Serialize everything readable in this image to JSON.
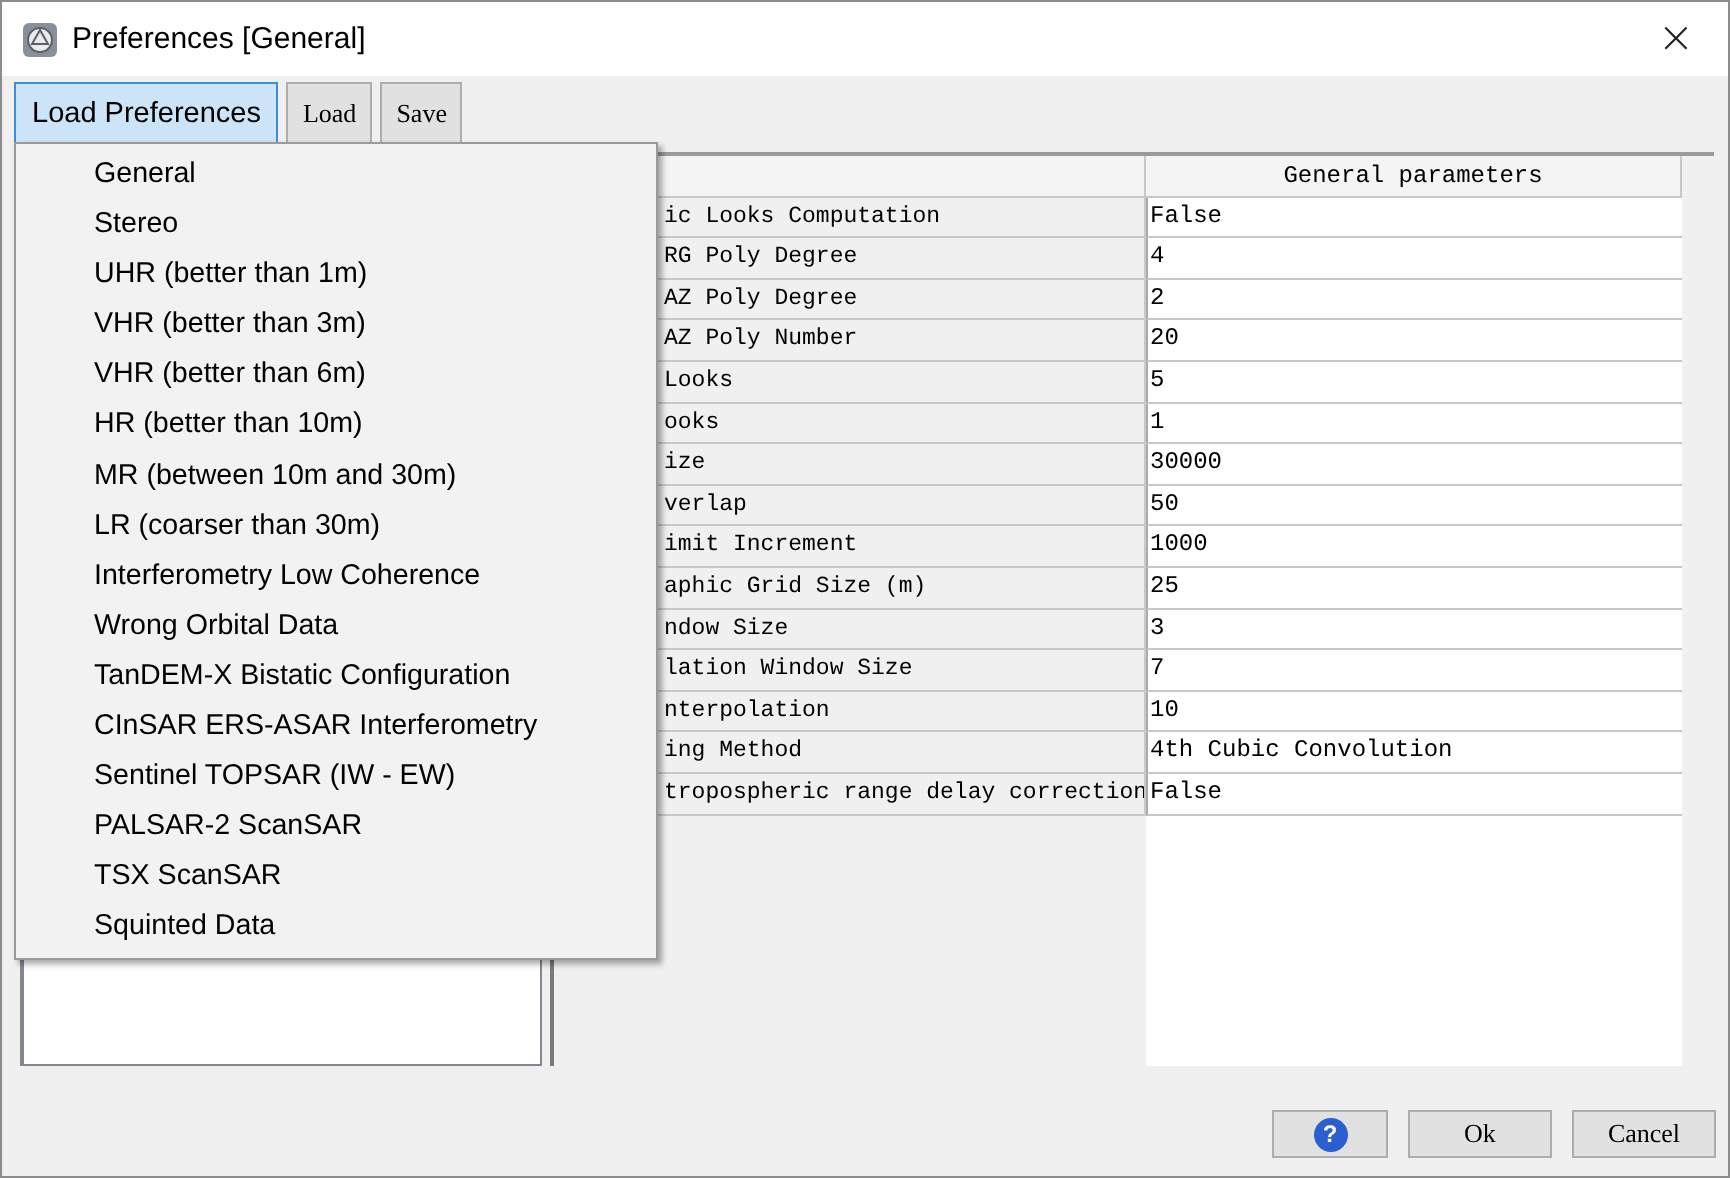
{
  "window": {
    "title": "Preferences [General]",
    "close": "×"
  },
  "toolbar": [
    {
      "label": "Load Preferences",
      "pressed": true,
      "kind": "menu"
    },
    {
      "label": "Load",
      "pressed": false,
      "kind": "plain"
    },
    {
      "label": "Save",
      "pressed": false,
      "kind": "plain"
    }
  ],
  "menu": {
    "items": [
      {
        "label": "General"
      },
      {
        "label": "Stereo"
      },
      {
        "label": "UHR (better than 1m)"
      },
      {
        "label": "VHR (better than 3m)"
      },
      {
        "label": "VHR (better than 6m)"
      },
      {
        "label": "HR (better than 10m)"
      },
      {
        "label": "MR (between 10m and 30m)"
      },
      {
        "label": "LR (coarser than 30m)"
      },
      {
        "label": "Interferometry Low Coherence"
      },
      {
        "label": "Wrong Orbital Data"
      },
      {
        "label": "TanDEM-X Bistatic Configuration"
      },
      {
        "label": "CInSAR ERS-ASAR Interferometry"
      },
      {
        "label": "Sentinel TOPSAR (IW - EW)"
      },
      {
        "label": "PALSAR-2 ScanSAR"
      },
      {
        "label": "TSX ScanSAR"
      },
      {
        "label": "Squinted Data"
      }
    ]
  },
  "table": {
    "header": "General parameters",
    "rows": [
      {
        "name": "ic Looks Computation",
        "value": "False"
      },
      {
        "name": "RG Poly Degree",
        "value": "4"
      },
      {
        "name": "AZ Poly Degree",
        "value": "2"
      },
      {
        "name": "AZ Poly Number",
        "value": "20"
      },
      {
        "name": "Looks",
        "value": "5"
      },
      {
        "name": "ooks",
        "value": "1"
      },
      {
        "name": "ize",
        "value": "30000"
      },
      {
        "name": "verlap",
        "value": "50"
      },
      {
        "name": "imit Increment",
        "value": "1000"
      },
      {
        "name": "aphic Grid Size (m)",
        "value": "25"
      },
      {
        "name": "ndow Size",
        "value": "3"
      },
      {
        "name": "lation Window Size",
        "value": "7"
      },
      {
        "name": "nterpolation",
        "value": "10"
      },
      {
        "name": "ing Method",
        "value": "4th Cubic Convolution"
      },
      {
        "name": "tropospheric range delay correction",
        "value": "False"
      }
    ]
  },
  "buttons": [
    {
      "kind": "help",
      "label": "?"
    },
    {
      "kind": "text",
      "label": "Ok"
    },
    {
      "kind": "text",
      "label": "Cancel"
    }
  ]
}
